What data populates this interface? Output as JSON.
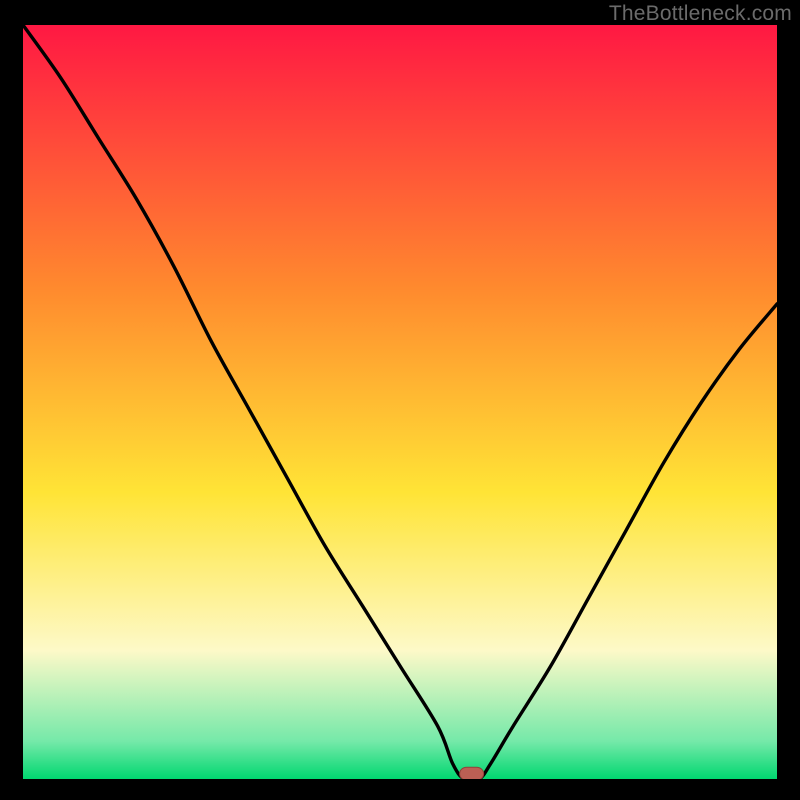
{
  "watermark": "TheBottleneck.com",
  "colors": {
    "frame": "#000000",
    "curve": "#000000",
    "marker_fill": "#bb5f54",
    "marker_stroke": "#8f423a",
    "grad_top": "#ff1843",
    "grad_mid1": "#ff8a2e",
    "grad_mid2": "#ffe436",
    "grad_pale": "#fdf9c8",
    "grad_mint": "#75e9a9",
    "grad_bottom": "#00d770"
  },
  "chart_data": {
    "type": "line",
    "title": "",
    "xlabel": "",
    "ylabel": "",
    "xlim": [
      0,
      100
    ],
    "ylim": [
      0,
      100
    ],
    "grid": false,
    "x": [
      0,
      5,
      10,
      15,
      20,
      25,
      30,
      35,
      40,
      45,
      50,
      55,
      57,
      58.5,
      60.5,
      62,
      65,
      70,
      75,
      80,
      85,
      90,
      95,
      100
    ],
    "y": [
      100,
      93,
      85,
      77,
      68,
      58,
      49,
      40,
      31,
      23,
      15,
      7,
      2,
      0,
      0,
      2,
      7,
      15,
      24,
      33,
      42,
      50,
      57,
      63
    ],
    "marker": {
      "x": 59.5,
      "y": 0.7
    },
    "note": "Bottleneck-style V-curve; y is approximate bottleneck percentage, x is component-scale position. Minimum (optimal point) marked by the pill."
  }
}
